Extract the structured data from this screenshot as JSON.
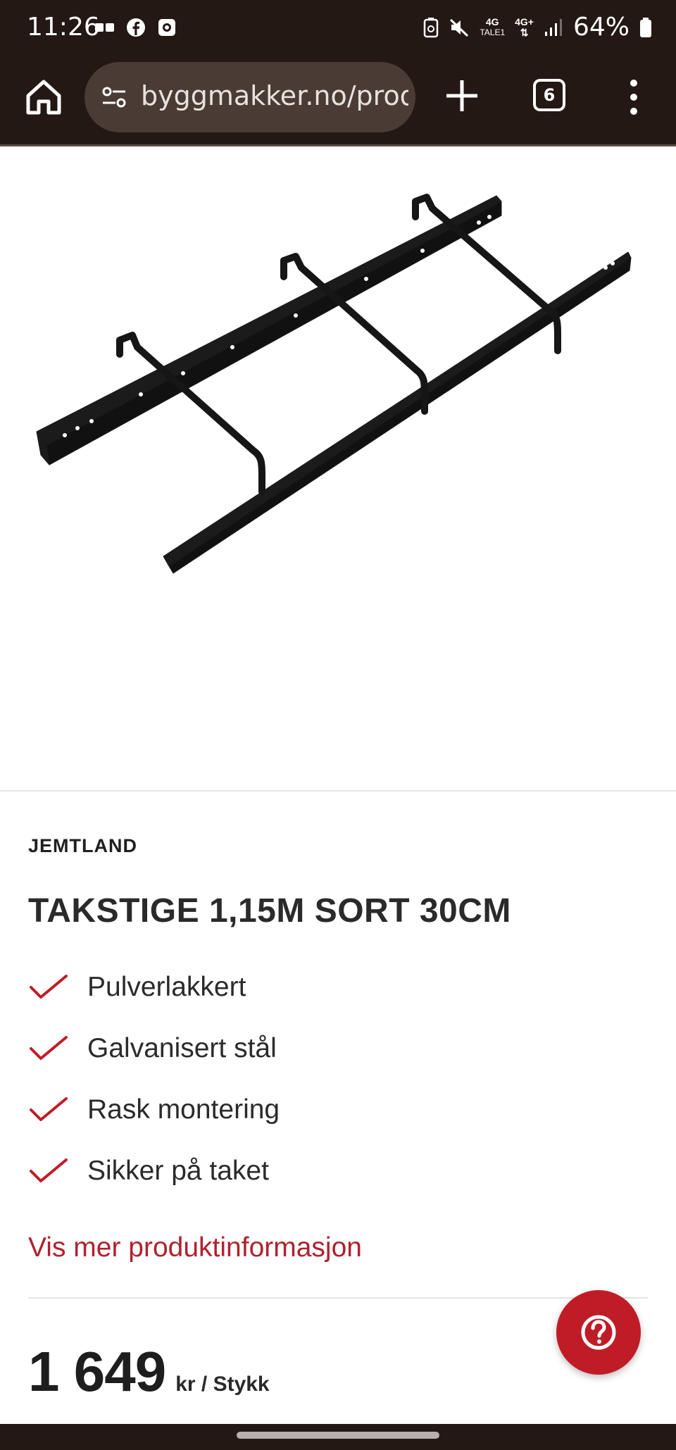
{
  "status_bar": {
    "time": "11:26",
    "battery_percent": "64%",
    "network_1_top": "4G",
    "network_1_bottom": "TALE1",
    "network_2_top": "4G+",
    "icons": [
      "voicemail-icon",
      "facebook-icon",
      "screen-record-icon",
      "battery-saver-icon",
      "mute-icon",
      "signal-icon",
      "battery-icon"
    ]
  },
  "browser": {
    "url": "byggmakker.no/prod",
    "tab_count": "6"
  },
  "product": {
    "brand": "JEMTLAND",
    "title": "TAKSTIGE 1,15M SORT 30CM",
    "features": [
      "Pulverlakkert",
      "Galvanisert stål",
      "Rask montering",
      "Sikker på taket"
    ],
    "more_info_link": "Vis mer produktinformasjon",
    "price": "1 649",
    "price_unit": "kr / Stykk"
  },
  "colors": {
    "browser_chrome": "#231814",
    "accent_red": "#c01c27",
    "link_red": "#b0212e"
  }
}
